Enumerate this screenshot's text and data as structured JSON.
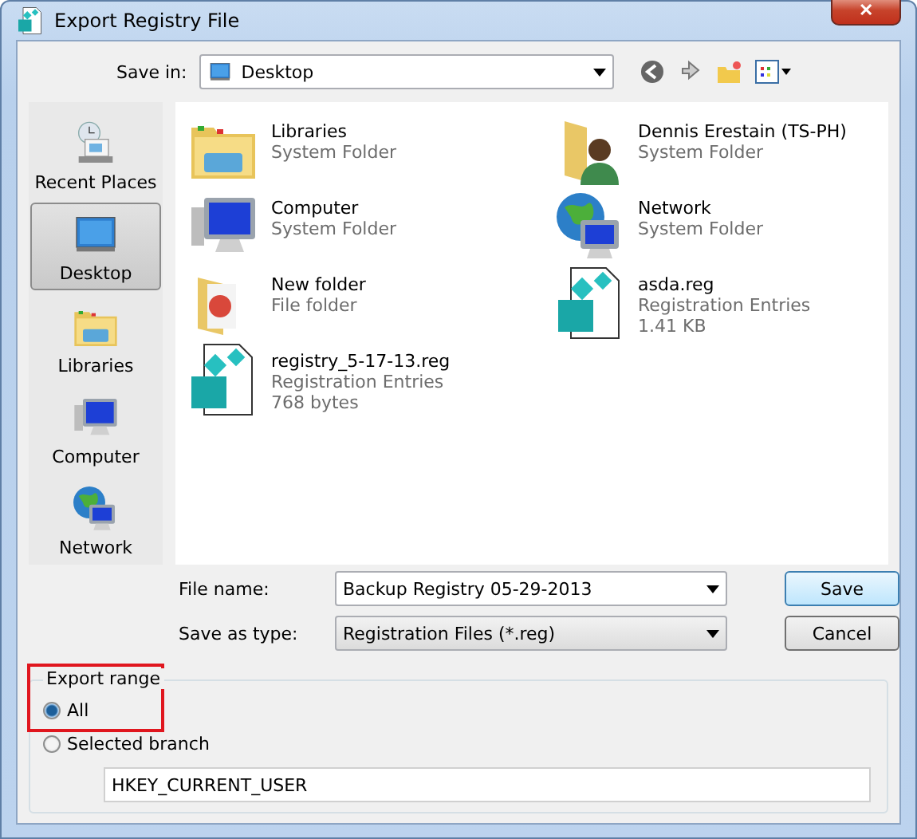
{
  "window": {
    "title": "Export Registry File",
    "close": "✕"
  },
  "save_in": {
    "label": "Save in:",
    "value": "Desktop"
  },
  "places": [
    {
      "label": "Recent Places",
      "kind": "recent",
      "selected": false
    },
    {
      "label": "Desktop",
      "kind": "desktop",
      "selected": true
    },
    {
      "label": "Libraries",
      "kind": "libraries",
      "selected": false
    },
    {
      "label": "Computer",
      "kind": "computer",
      "selected": false
    },
    {
      "label": "Network",
      "kind": "network",
      "selected": false
    }
  ],
  "files": [
    {
      "name": "Libraries",
      "kind": "libraries",
      "details": [
        "System Folder"
      ]
    },
    {
      "name": "Dennis Erestain (TS-PH)",
      "kind": "user",
      "details": [
        "System Folder"
      ]
    },
    {
      "name": "Computer",
      "kind": "computer",
      "details": [
        "System Folder"
      ]
    },
    {
      "name": "Network",
      "kind": "network",
      "details": [
        "System Folder"
      ]
    },
    {
      "name": "New folder",
      "kind": "folder",
      "details": [
        "File folder"
      ]
    },
    {
      "name": "asda.reg",
      "kind": "reg",
      "details": [
        "Registration Entries",
        "1.41 KB"
      ]
    },
    {
      "name": "registry_5-17-13.reg",
      "kind": "reg",
      "details": [
        "Registration Entries",
        "768 bytes"
      ]
    }
  ],
  "file_name": {
    "label": "File name:",
    "value": "Backup Registry 05-29-2013"
  },
  "save_as_type": {
    "label": "Save as type:",
    "value": "Registration Files (*.reg)"
  },
  "buttons": [
    {
      "label": "Save",
      "default": true
    },
    {
      "label": "Cancel",
      "default": false
    }
  ],
  "export_range": {
    "title": "Export range",
    "highlighted": true,
    "options": [
      {
        "label": "All",
        "selected": true
      },
      {
        "label": "Selected branch",
        "selected": false
      }
    ],
    "branch": "HKEY_CURRENT_USER"
  }
}
